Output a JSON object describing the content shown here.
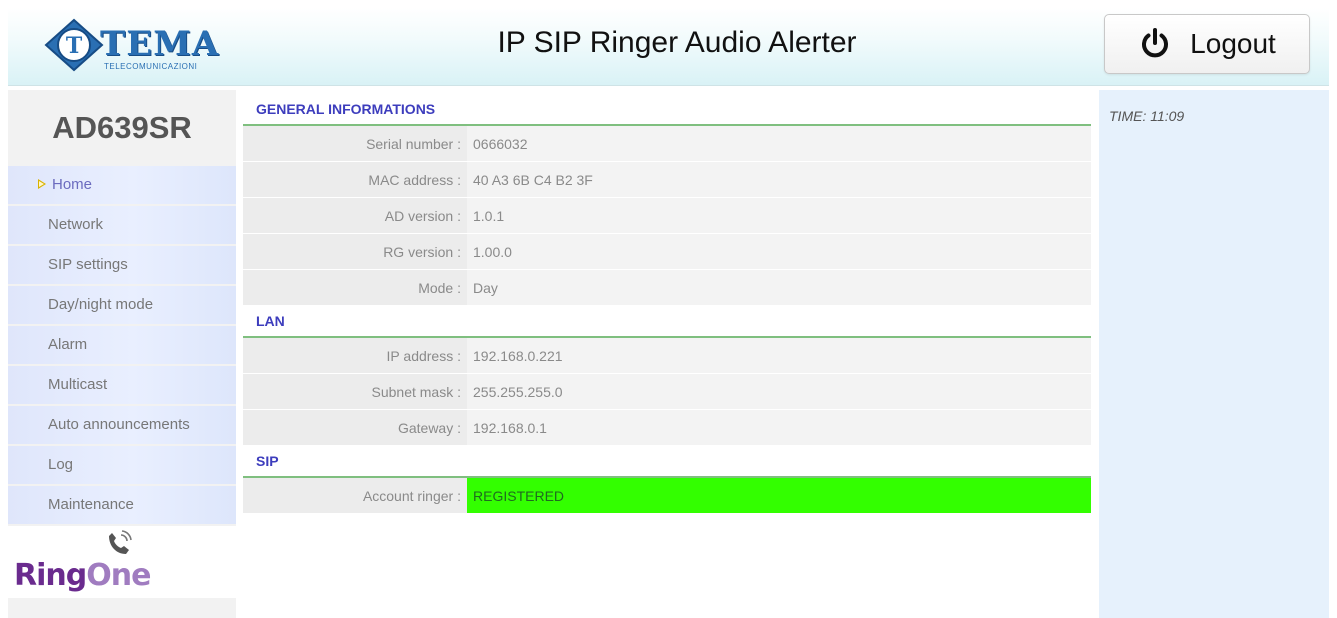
{
  "header": {
    "logo_word": "TEMA",
    "logo_sub": "TELECOMUNICAZIONI",
    "title": "IP SIP Ringer Audio Alerter",
    "logout_label": "Logout"
  },
  "sidebar": {
    "device_name": "AD639SR",
    "items": [
      {
        "label": "Home",
        "active": true
      },
      {
        "label": "Network"
      },
      {
        "label": "SIP settings"
      },
      {
        "label": "Day/night mode"
      },
      {
        "label": "Alarm"
      },
      {
        "label": "Multicast"
      },
      {
        "label": "Auto announcements"
      },
      {
        "label": "Log"
      },
      {
        "label": "Maintenance"
      }
    ],
    "brand_logo": {
      "part1": "Ring",
      "part2": "One"
    }
  },
  "sections": [
    {
      "title": "GENERAL INFORMATIONS",
      "rows": [
        {
          "label": "Serial number :",
          "value": "0666032"
        },
        {
          "label": "MAC address :",
          "value": "40 A3 6B C4 B2 3F"
        },
        {
          "label": "AD version :",
          "value": "1.0.1"
        },
        {
          "label": "RG version :",
          "value": "1.00.0"
        },
        {
          "label": "Mode :",
          "value": "Day"
        }
      ]
    },
    {
      "title": "LAN",
      "rows": [
        {
          "label": "IP address :",
          "value": "192.168.0.221"
        },
        {
          "label": "Subnet mask :",
          "value": "255.255.255.0"
        },
        {
          "label": "Gateway :",
          "value": "192.168.0.1"
        }
      ]
    },
    {
      "title": "SIP",
      "rows": [
        {
          "label": "Account ringer :",
          "value": "REGISTERED"
        }
      ]
    }
  ],
  "status": {
    "time": "TIME: 11:09"
  },
  "colors": {
    "accent": "#3d3dbd",
    "registered": "#33ff00",
    "tema_blue": "#2a6fb3",
    "ringone_purple": "#6a2b8e"
  },
  "icons": {
    "logout": "power-icon",
    "brand": "phone-ringing-icon",
    "active_marker": "arrow-right-icon"
  }
}
